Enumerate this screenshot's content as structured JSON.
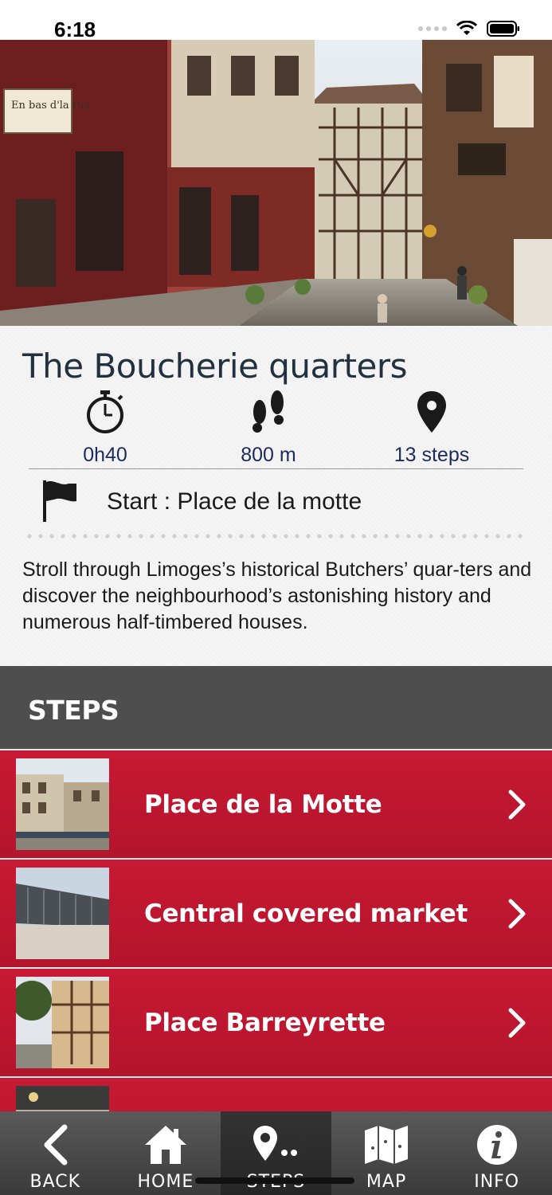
{
  "status_bar": {
    "time": "6:18"
  },
  "tour": {
    "title": "The Boucherie quarters",
    "duration": "0h40",
    "distance": "800 m",
    "steps_count": "13 steps",
    "start": "Start : Place de la motte",
    "description": "Stroll through Limoges’s historical Butchers’ quar-ters and discover the neighbourhood’s astonishing history and numerous half-timbered houses.",
    "hero_sign": "En bas d'la rue"
  },
  "steps_section": {
    "title": "STEPS",
    "items": [
      {
        "label": "Place de la Motte"
      },
      {
        "label": "Central covered market"
      },
      {
        "label": "Place Barreyrette"
      },
      {
        "label": ""
      }
    ]
  },
  "tabbar": {
    "back": "BACK",
    "home": "HOME",
    "steps": "STEPS",
    "map": "MAP",
    "info": "INFO"
  },
  "colors": {
    "accent": "#c41a33",
    "tab_bg": "#4a4a4a",
    "title_text": "#22313f"
  },
  "icons": [
    "stopwatch-icon",
    "footsteps-icon",
    "location-pin-icon",
    "flag-icon",
    "chevron-right-icon",
    "back-icon",
    "home-icon",
    "steps-icon",
    "map-icon",
    "info-icon"
  ]
}
